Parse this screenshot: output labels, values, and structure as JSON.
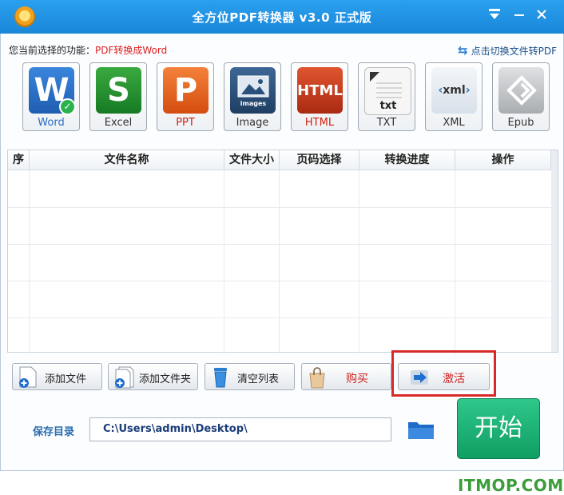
{
  "window": {
    "title": "全方位PDF转换器 v3.0 正式版"
  },
  "function": {
    "label": "您当前选择的功能：",
    "value": "PDF转换成Word",
    "switch_link": "点击切换文件转PDF"
  },
  "file_types": [
    {
      "label": "Word",
      "icon": "word-icon",
      "color": "#2b6cc4",
      "selected": true
    },
    {
      "label": "Excel",
      "icon": "excel-icon",
      "color": "#1f8a2e"
    },
    {
      "label": "PPT",
      "icon": "ppt-icon",
      "color": "#e05a1a"
    },
    {
      "label": "Image",
      "icon": "image-icon",
      "color": "#2a4f7a",
      "sub": "images"
    },
    {
      "label": "HTML",
      "icon": "html-icon",
      "color": "#c0361d"
    },
    {
      "label": "TXT",
      "icon": "txt-icon",
      "color": "#efefef",
      "sub": "txt"
    },
    {
      "label": "XML",
      "icon": "xml-icon",
      "color": "#e9eef3",
      "sub": "xml"
    },
    {
      "label": "Epub",
      "icon": "epub-icon",
      "color": "#c6c9cc"
    }
  ],
  "table": {
    "columns": [
      "序",
      "文件名称",
      "文件大小",
      "页码选择",
      "转换进度",
      "操作"
    ],
    "rows": [
      [],
      [],
      [],
      [],
      []
    ]
  },
  "buttons": {
    "add_file": "添加文件",
    "add_folder": "添加文件夹",
    "clear_list": "清空列表",
    "buy": "购买",
    "activate": "激活"
  },
  "save": {
    "label": "保存目录",
    "path": "C:\\Users\\admin\\Desktop\\"
  },
  "start_button": "开始",
  "watermark": "ITMOP.COM"
}
